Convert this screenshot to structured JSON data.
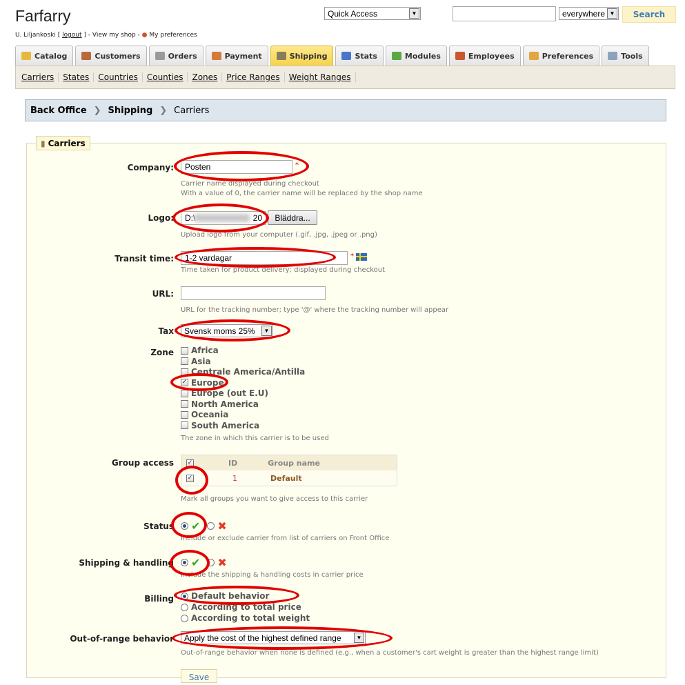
{
  "header": {
    "shop_title": "Farfarry",
    "user_name": "U. Liljankoski",
    "logout": "logout",
    "view_shop": "View my shop",
    "preferences": "My preferences",
    "quick_access": "Quick Access",
    "search_value": "",
    "search_scope": "everywhere",
    "search_button": "Search"
  },
  "tabs": [
    {
      "label": "Catalog",
      "icon": "folder-icon",
      "color": "#e7b840"
    },
    {
      "label": "Customers",
      "icon": "user-icon",
      "color": "#b86a3b"
    },
    {
      "label": "Orders",
      "icon": "cart-icon",
      "color": "#9a9a9a"
    },
    {
      "label": "Payment",
      "icon": "calendar-icon",
      "color": "#d47a3a"
    },
    {
      "label": "Shipping",
      "icon": "truck-icon",
      "color": "#8a7d5b",
      "active": true
    },
    {
      "label": "Stats",
      "icon": "chart-icon",
      "color": "#4a76c8"
    },
    {
      "label": "Modules",
      "icon": "puzzle-icon",
      "color": "#5aa744"
    },
    {
      "label": "Employees",
      "icon": "person-icon",
      "color": "#c8562e"
    },
    {
      "label": "Preferences",
      "icon": "pencil-icon",
      "color": "#e1a640"
    },
    {
      "label": "Tools",
      "icon": "wrench-icon",
      "color": "#8da2bd"
    }
  ],
  "subnav": [
    "Carriers",
    "States",
    "Countries",
    "Counties",
    "Zones",
    "Price Ranges",
    "Weight Ranges"
  ],
  "breadcrumb": [
    "Back Office",
    "Shipping",
    "Carriers"
  ],
  "form": {
    "legend": "Carriers",
    "company": {
      "label": "Company:",
      "value": "Posten",
      "required": "*",
      "hint1": "Carrier name displayed during checkout",
      "hint2": "With a value of 0, the carrier name will be replaced by the shop name"
    },
    "logo": {
      "label": "Logo:",
      "value": "D:\\",
      "value_tail": "20",
      "browse": "Bläddra...",
      "hint": "Upload logo from your computer (.gif, .jpg, .jpeg or .png)"
    },
    "transit": {
      "label": "Transit time:",
      "value": "1-2 vardagar",
      "required": "*",
      "hint": "Time taken for product delivery; displayed during checkout"
    },
    "url": {
      "label": "URL:",
      "value": "",
      "hint": "URL for the tracking number; type '@' where the tracking number will appear"
    },
    "tax": {
      "label": "Tax",
      "value": "Svensk moms 25%"
    },
    "zone": {
      "label": "Zone",
      "items": [
        {
          "name": "Africa",
          "checked": false
        },
        {
          "name": "Asia",
          "checked": false
        },
        {
          "name": "Centrale America/Antilla",
          "checked": false
        },
        {
          "name": "Europe",
          "checked": true
        },
        {
          "name": "Europe (out E.U)",
          "checked": false
        },
        {
          "name": "North America",
          "checked": false
        },
        {
          "name": "Oceania",
          "checked": false
        },
        {
          "name": "South America",
          "checked": false
        }
      ],
      "hint": "The zone in which this carrier is to be used"
    },
    "group_access": {
      "label": "Group access",
      "col_id": "ID",
      "col_name": "Group name",
      "rows": [
        {
          "id": "1",
          "name": "Default",
          "checked": true
        }
      ],
      "hint": "Mark all groups you want to give access to this carrier"
    },
    "status": {
      "label": "Status",
      "hint": "Include or exclude carrier from list of carriers on Front Office"
    },
    "shipping_handling": {
      "label": "Shipping & handling",
      "hint": "Include the shipping & handling costs in carrier price"
    },
    "billing": {
      "label": "Billing",
      "options": [
        "Default behavior",
        "According to total price",
        "According to total weight"
      ],
      "selected": 0
    },
    "out_of_range": {
      "label": "Out-of-range behavior",
      "value": "Apply the cost of the highest defined range",
      "hint": "Out-of-range behavior when none is defined (e.g., when a customer's cart weight is greater than the highest range limit)"
    },
    "save": "Save"
  },
  "colors": {
    "annotation_ring": "#e20000",
    "accent_tab": "#f7d24c",
    "link_blue": "#3a7dbb"
  }
}
